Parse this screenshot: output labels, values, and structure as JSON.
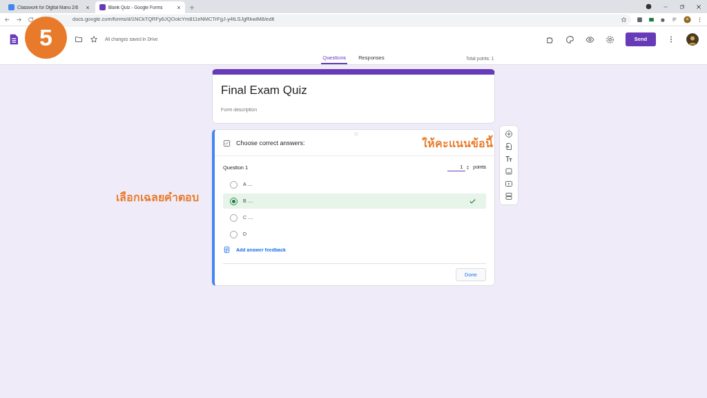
{
  "browser": {
    "tabs": [
      {
        "title": "Classwork for Digital Manu 2/6",
        "selected": false
      },
      {
        "title": "Blank Quiz - Google Forms",
        "selected": true
      }
    ],
    "url": "docs.google.com/forms/d/1NCkTQRFy6JQOolcYm811eNMCTrFgJ-y4tLSJgRkwiM8/edit"
  },
  "header": {
    "status": "All changes saved in Drive",
    "send": "Send"
  },
  "nav": {
    "tabs": [
      {
        "label": "Questions",
        "selected": true
      },
      {
        "label": "Responses",
        "selected": false
      }
    ],
    "total_points": "Total points: 1"
  },
  "form": {
    "title": "Final Exam Quiz",
    "description_placeholder": "Form description"
  },
  "question_card": {
    "header": "Choose correct answers:",
    "question": "Question 1",
    "points_value": "1",
    "points_label": "points",
    "options": [
      {
        "label": "A ....",
        "selected": false
      },
      {
        "label": "B ....",
        "selected": true
      },
      {
        "label": "C ....",
        "selected": false
      },
      {
        "label": "D",
        "selected": false
      }
    ],
    "feedback": "Add answer feedback",
    "done": "Done"
  },
  "annotations": {
    "step": "5",
    "card_note": "ให้คะแนนข้อนี้",
    "side_note": "เลือกเฉลยคำตอบ"
  }
}
